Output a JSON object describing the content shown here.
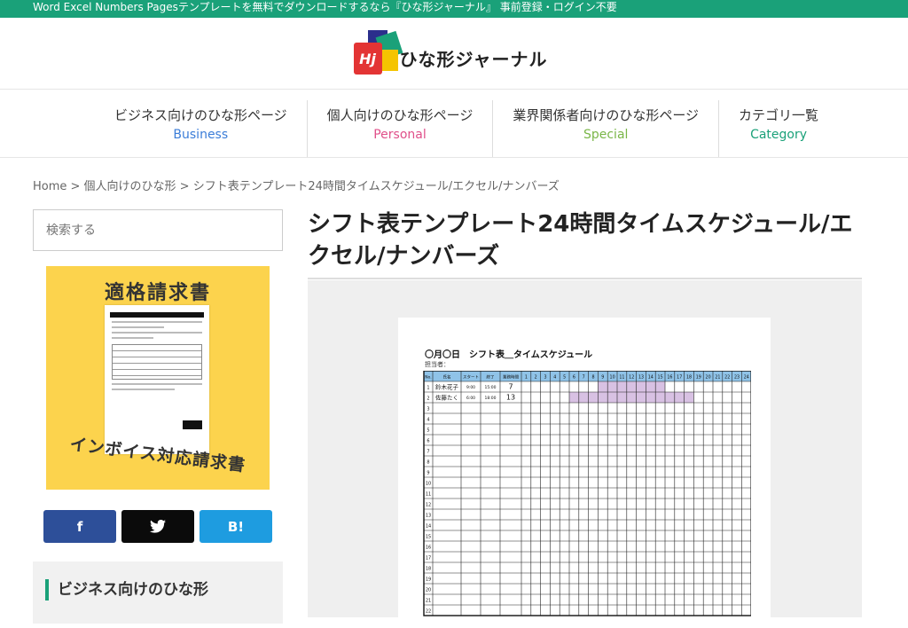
{
  "topbar": {
    "text": "Word Excel Numbers Pagesテンプレートを無料でダウンロードするなら『ひな形ジャーナル』 事前登録・ログイン不要"
  },
  "logo": {
    "mark": "Hj",
    "text": "ひな形ジャーナル"
  },
  "nav": [
    {
      "jp": "ビジネス向けのひな形ページ",
      "en": "Business",
      "color": "#3b7dd8"
    },
    {
      "jp": "個人向けのひな形ページ",
      "en": "Personal",
      "color": "#e0508a"
    },
    {
      "jp": "業界関係者向けのひな形ページ",
      "en": "Special",
      "color": "#7ab648"
    },
    {
      "jp": "カテゴリ一覧",
      "en": "Category",
      "color": "#1aa179"
    }
  ],
  "breadcrumb": {
    "text": "Home > 個人向けのひな形 > シフト表テンプレート24時間タイムスケジュール/エクセル/ナンバーズ"
  },
  "search": {
    "placeholder": "検索する"
  },
  "banner": {
    "top": "適格請求書",
    "bottom": "インボイス対応請求書"
  },
  "share": {
    "facebook": "f",
    "twitter": "t",
    "hatena": "B!"
  },
  "widget": {
    "title": "ビジネス向けのひな形"
  },
  "post": {
    "title": "シフト表テンプレート24時間タイムスケジュール/エクセル/ナンバーズ"
  },
  "sheet": {
    "title": "〇月〇日　シフト表＿タイムスケジュール",
    "sub": "担当者：",
    "headers": [
      "No.",
      "氏名",
      "スタート",
      "終了",
      "業務時間"
    ],
    "hours": [
      "1",
      "2",
      "3",
      "4",
      "5",
      "6",
      "7",
      "8",
      "9",
      "10",
      "11",
      "12",
      "13",
      "14",
      "15",
      "16",
      "17",
      "18",
      "19",
      "20",
      "21",
      "22",
      "23",
      "24"
    ],
    "rows": [
      {
        "no": "1",
        "name": "鈴木花子",
        "start": "9:00",
        "end": "15:00",
        "hours": "7",
        "from": 9,
        "to": 15
      },
      {
        "no": "2",
        "name": "佐藤たく",
        "start": "6:00",
        "end": "18:00",
        "hours": "13",
        "from": 6,
        "to": 18
      }
    ],
    "row_count": 22,
    "header_color": "#8fc3e8",
    "bar_color": "#d8c1e3"
  }
}
